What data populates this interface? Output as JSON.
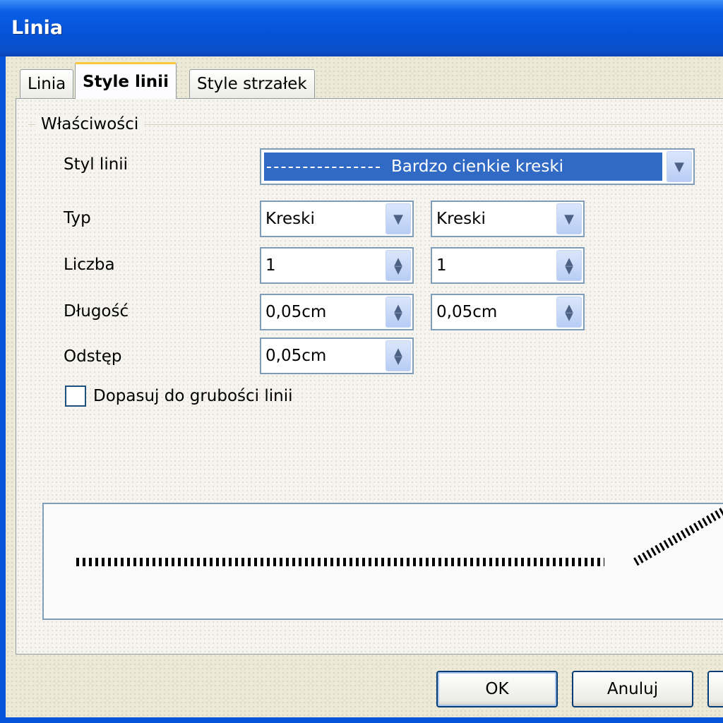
{
  "window": {
    "title": "Linia"
  },
  "tabs": [
    {
      "label": "Linia",
      "active": false
    },
    {
      "label": "Style linii",
      "active": true
    },
    {
      "label": "Style strzałek",
      "active": false
    }
  ],
  "properties": {
    "group_label": "Właściwości",
    "line_style": {
      "label": "Styl linii",
      "value": "Bardzo cienkie kreski"
    },
    "type": {
      "label": "Typ",
      "value_1": "Kreski",
      "value_2": "Kreski"
    },
    "count": {
      "label": "Liczba",
      "value_1": "1",
      "value_2": "1"
    },
    "length": {
      "label": "Długość",
      "value_1": "0,05cm",
      "value_2": "0,05cm"
    },
    "spacing": {
      "label": "Odstęp",
      "value": "0,05cm"
    },
    "fit_to_width": {
      "label": "Dopasuj do grubości linii",
      "checked": false
    }
  },
  "buttons": {
    "ok": "OK",
    "cancel": "Anuluj"
  },
  "colors": {
    "title_bar": "#0553d8",
    "selection": "#316ac5",
    "active_tab_highlight": "#ffc83c"
  },
  "icons": {
    "dropdown": "chevron-down-icon",
    "spinner": "up-down-arrows-icon"
  }
}
